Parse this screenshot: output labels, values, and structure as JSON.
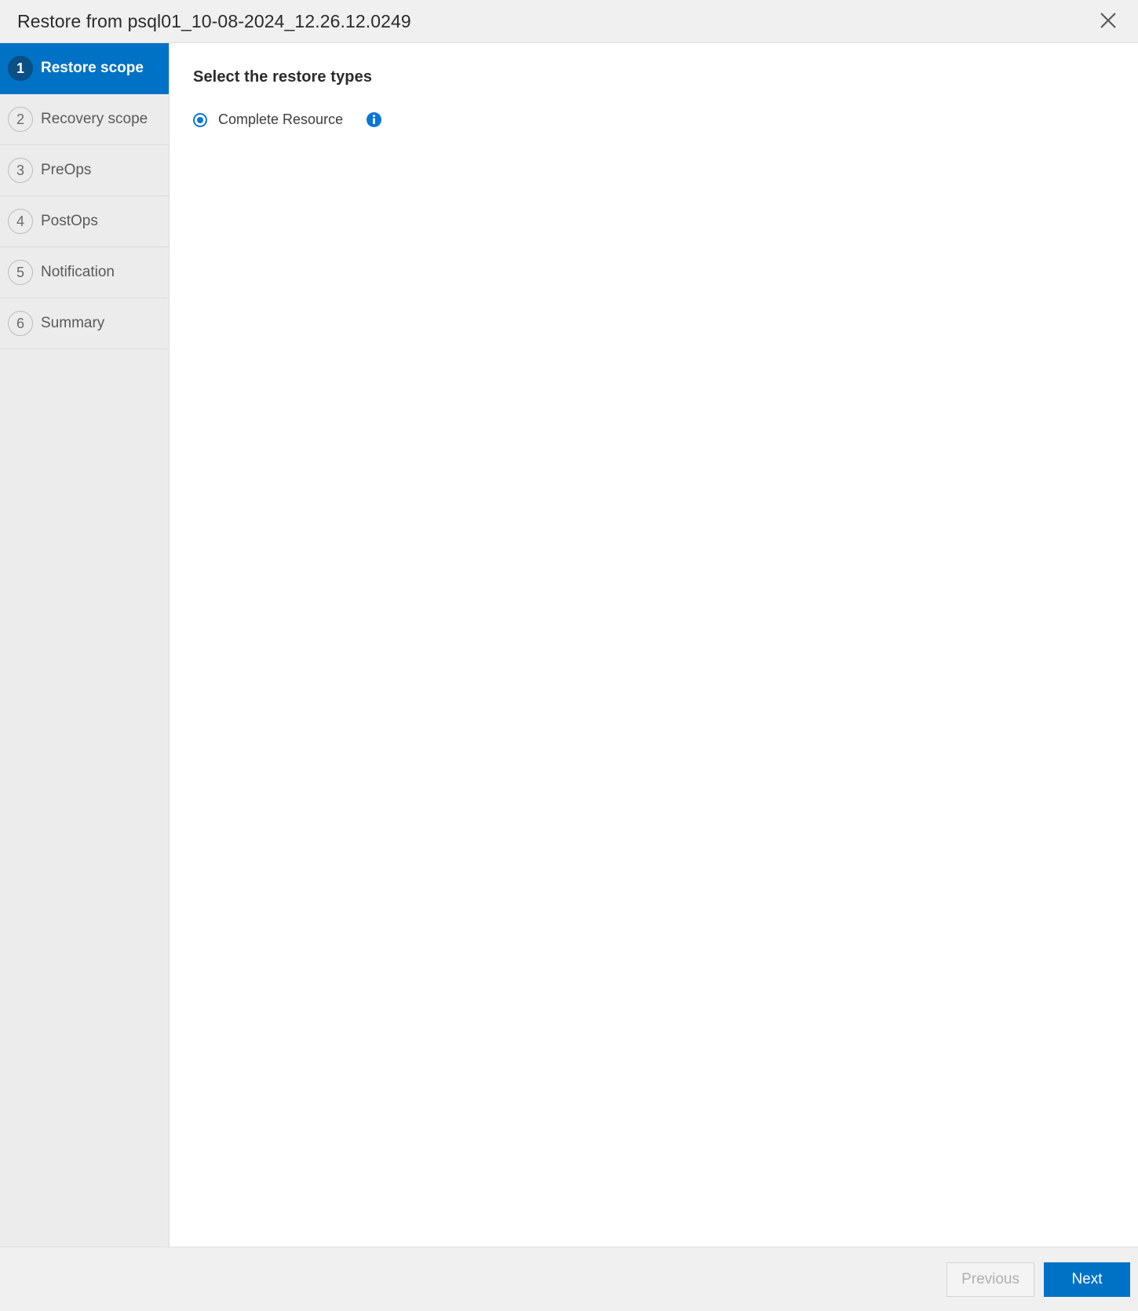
{
  "header": {
    "title": "Restore from psql01_10-08-2024_12.26.12.0249",
    "close_icon": "close-icon"
  },
  "sidebar": {
    "steps": [
      {
        "number": "1",
        "label": "Restore scope",
        "active": true
      },
      {
        "number": "2",
        "label": "Recovery scope",
        "active": false
      },
      {
        "number": "3",
        "label": "PreOps",
        "active": false
      },
      {
        "number": "4",
        "label": "PostOps",
        "active": false
      },
      {
        "number": "5",
        "label": "Notification",
        "active": false
      },
      {
        "number": "6",
        "label": "Summary",
        "active": false
      }
    ]
  },
  "main": {
    "heading": "Select the restore types",
    "options": [
      {
        "label": "Complete Resource",
        "selected": true,
        "info_icon": "info-icon"
      }
    ]
  },
  "footer": {
    "previous_label": "Previous",
    "next_label": "Next"
  },
  "colors": {
    "accent": "#0072c6",
    "active_step_circle": "#0b4f85",
    "radio_blue": "#0a76d6",
    "info_blue": "#0a76d6",
    "sidebar_bg": "#ececec",
    "header_bg": "#f0f0f0"
  }
}
